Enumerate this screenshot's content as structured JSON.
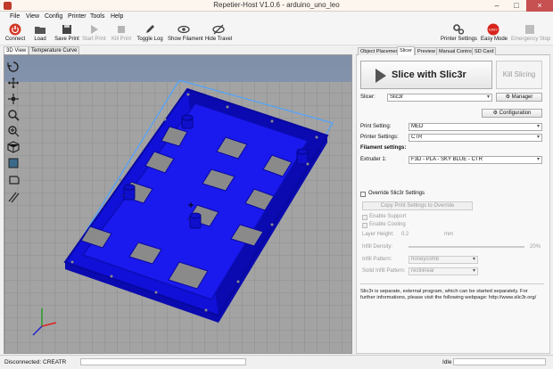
{
  "window": {
    "title": "Repetier-Host V1.0.6 - arduino_uno_leo"
  },
  "menu": [
    "File",
    "View",
    "Config",
    "Printer",
    "Tools",
    "Help"
  ],
  "toolbar": {
    "connect": "Connect",
    "load": "Load",
    "save_print": "Save Print",
    "start_print": "Start Print",
    "kill_print": "Kill Print",
    "toggle_log": "Toggle Log",
    "show_filament": "Show Filament",
    "hide_travel": "Hide Travel",
    "printer_settings": "Printer Settings",
    "easy_mode": "Easy Mode",
    "emergency_stop": "Emergency Stop",
    "easy_badge": "EASY"
  },
  "view_tabs": [
    "3D View",
    "Temperature Curve"
  ],
  "right_tabs": [
    "Object Placement",
    "Slicer",
    "Preview",
    "Manual Control",
    "SD Card"
  ],
  "slicer": {
    "slice_button": "Slice with Slic3r",
    "kill_button": "Kill Slicing",
    "slicer_label": "Slicer:",
    "slicer_value": "Slic3r",
    "manager_button": "Manager",
    "configuration_button": "Configuration",
    "print_setting_label": "Print Setting:",
    "print_setting_value": "MED",
    "printer_setting_label": "Printer Settings:",
    "printer_setting_value": "CTR",
    "filament_header": "Filament settings:",
    "extruder_label": "Extruder 1:",
    "extruder_value": "F3D - PLA - SKY BLUE - CTR",
    "override_label": "Override Slic3r Settings",
    "copy_button": "Copy Print Settings to Override",
    "enable_support": "Enable Support",
    "enable_cooling": "Enable Cooling",
    "layer_height_label": "Layer Height:",
    "layer_height_value": "0.2",
    "layer_height_unit": "mm",
    "infill_density_label": "Infill Density:",
    "infill_density_value": "20%",
    "infill_pattern_label": "Infill Pattern:",
    "infill_pattern_value": "honeycomb",
    "solid_infill_label": "Solid Infill Pattern:",
    "solid_infill_value": "rectilinear",
    "note": "Slic3r is separate, external program, which can be started separately. For further informations, please visit the following webpage: http://www.slic3r.org/"
  },
  "status": {
    "connection": "Disconnected: CREATR",
    "state": "Idle"
  },
  "colors": {
    "part": "#1a1aee",
    "bed": "#a3a3a3",
    "background": "#8b9cb5",
    "selection_box": "#4fa3ff"
  }
}
